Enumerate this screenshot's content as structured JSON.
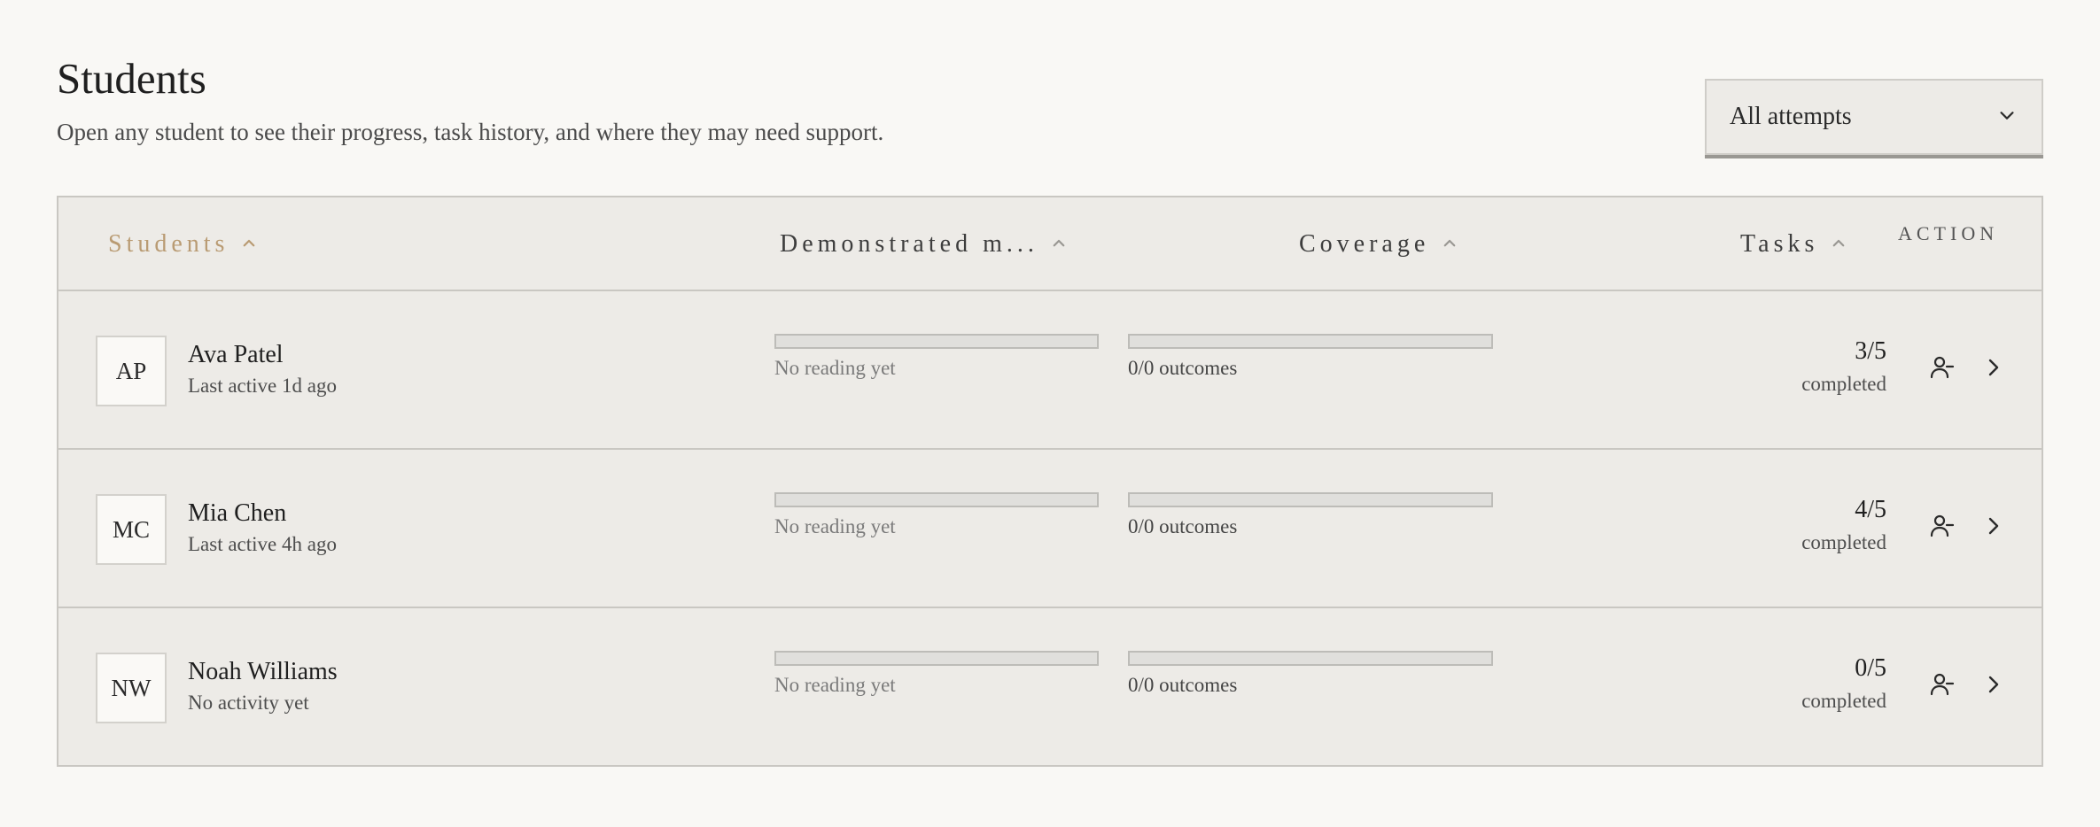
{
  "header": {
    "title": "Students",
    "subtitle": "Open any student to see their progress, task history, and where they may need support."
  },
  "filter": {
    "selected": "All attempts",
    "icon": "chevron-down-icon"
  },
  "table": {
    "columns": [
      {
        "label": "Students",
        "sort_icon": "chevron-up-icon",
        "active": true
      },
      {
        "label": "Demonstrated m...",
        "sort_icon": "chevron-up-icon",
        "active": false
      },
      {
        "label": "Coverage",
        "sort_icon": "chevron-up-icon",
        "active": false
      },
      {
        "label": "Tasks",
        "sort_icon": "chevron-up-icon",
        "active": false
      }
    ],
    "action_label": "ACTION",
    "rows": [
      {
        "initials": "AP",
        "name": "Ava Patel",
        "activity": "Last active 1d ago",
        "mastery_progress": 0,
        "mastery_note": "No reading yet",
        "coverage_progress": 0,
        "coverage_note": "0/0 outcomes",
        "tasks_count": "3/5",
        "tasks_label": "completed"
      },
      {
        "initials": "MC",
        "name": "Mia Chen",
        "activity": "Last active 4h ago",
        "mastery_progress": 0,
        "mastery_note": "No reading yet",
        "coverage_progress": 0,
        "coverage_note": "0/0 outcomes",
        "tasks_count": "4/5",
        "tasks_label": "completed"
      },
      {
        "initials": "NW",
        "name": "Noah Williams",
        "activity": "No activity yet",
        "mastery_progress": 0,
        "mastery_note": "No reading yet",
        "coverage_progress": 0,
        "coverage_note": "0/0 outcomes",
        "tasks_count": "0/5",
        "tasks_label": "completed"
      }
    ]
  },
  "colors": {
    "background": "#f9f8f5",
    "table_bg": "#edebe7",
    "accent": "#b99b73",
    "border": "#c9c7c2"
  }
}
